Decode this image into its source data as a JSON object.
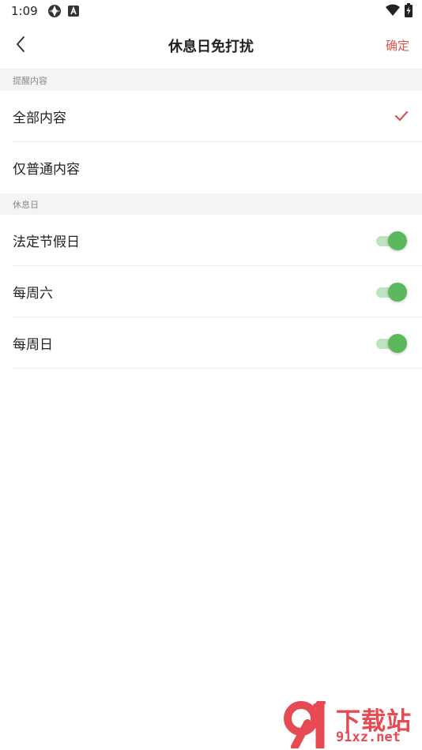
{
  "status_bar": {
    "time": "1:09",
    "icons": [
      "sync-icon",
      "app-a-icon",
      "wifi-icon",
      "battery-charging-icon"
    ]
  },
  "header": {
    "title": "休息日免打扰",
    "back_icon": "chevron-left-icon",
    "confirm_label": "确定"
  },
  "sections": {
    "reminder_content": {
      "title": "提醒内容",
      "options": [
        {
          "label": "全部内容",
          "selected": true
        },
        {
          "label": "仅普通内容",
          "selected": false
        }
      ]
    },
    "rest_days": {
      "title": "休息日",
      "items": [
        {
          "label": "法定节假日",
          "enabled": true
        },
        {
          "label": "每周六",
          "enabled": true
        },
        {
          "label": "每周日",
          "enabled": true
        }
      ]
    }
  },
  "watermark": {
    "logo_text": "91",
    "title": "下载站",
    "url": "91xz.net"
  },
  "colors": {
    "accent_red": "#d9534f",
    "toggle_green": "#5cb85c",
    "toggle_track": "#bfe3bf",
    "section_bg": "#f4f4f4",
    "watermark_red": "#e64a53"
  }
}
